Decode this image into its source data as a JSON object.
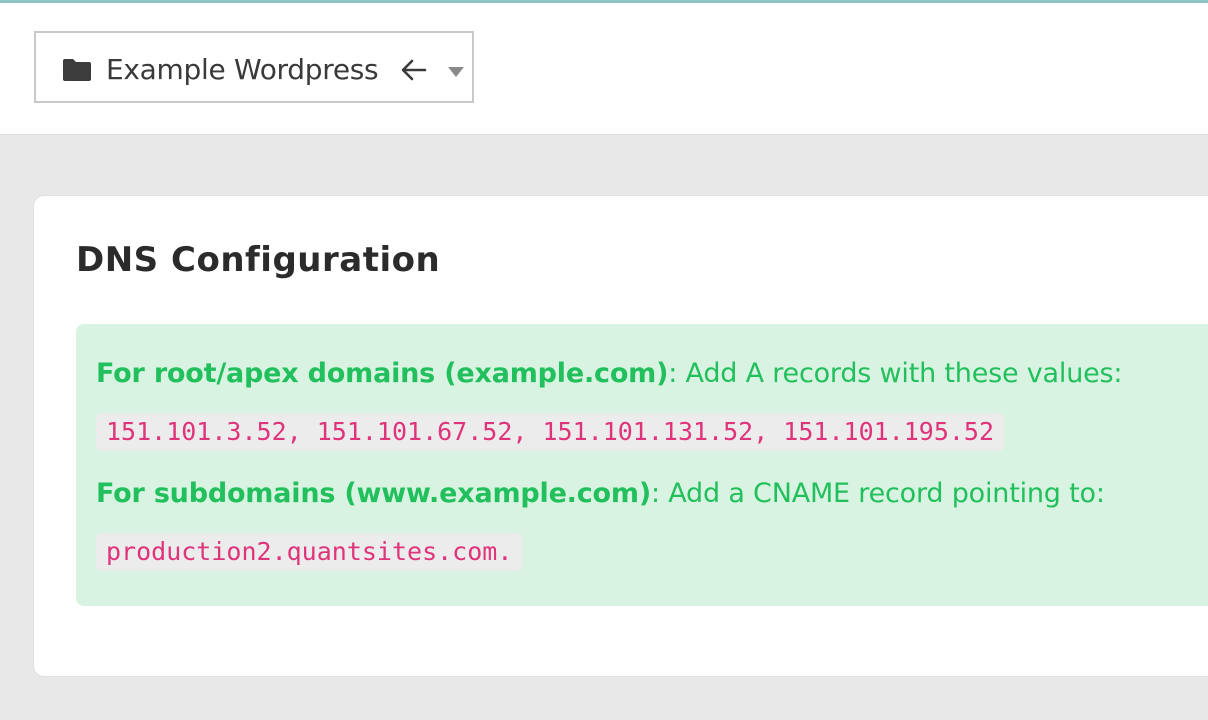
{
  "header": {
    "project_selector": {
      "icon": "folder-icon",
      "label": "Example Wordpress",
      "back_icon": "arrow-left-icon",
      "dropdown_icon": "caret-down-icon"
    }
  },
  "dns_card": {
    "title": "DNS Configuration",
    "notice": {
      "apex": {
        "label": "For root/apex domains (example.com)",
        "text": ": Add A records with these values:",
        "values": "151.101.3.52, 151.101.67.52, 151.101.131.52, 151.101.195.52"
      },
      "subdomain": {
        "label": "For subdomains (www.example.com)",
        "text": ": Add a CNAME record pointing to:",
        "value": "production2.quantsites.com."
      }
    }
  },
  "colors": {
    "accent_bar": "#8fc3c6",
    "notice_background": "#d9f3e2",
    "notice_text": "#22c05c",
    "code_text": "#e0347a",
    "code_background": "#ececec"
  }
}
